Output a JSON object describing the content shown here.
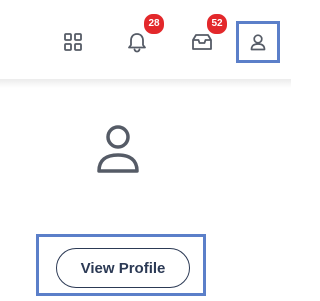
{
  "header": {
    "notifications_count": "28",
    "inbox_count": "52"
  },
  "profile": {
    "view_profile_label": "View Profile"
  },
  "colors": {
    "badge": "#e3282b",
    "highlight": "#5b7fc9",
    "icon": "#555b66",
    "button_text": "#2c3a55"
  },
  "icons": [
    "apps-grid-icon",
    "bell-icon",
    "inbox-icon",
    "user-icon",
    "user-avatar-icon"
  ]
}
